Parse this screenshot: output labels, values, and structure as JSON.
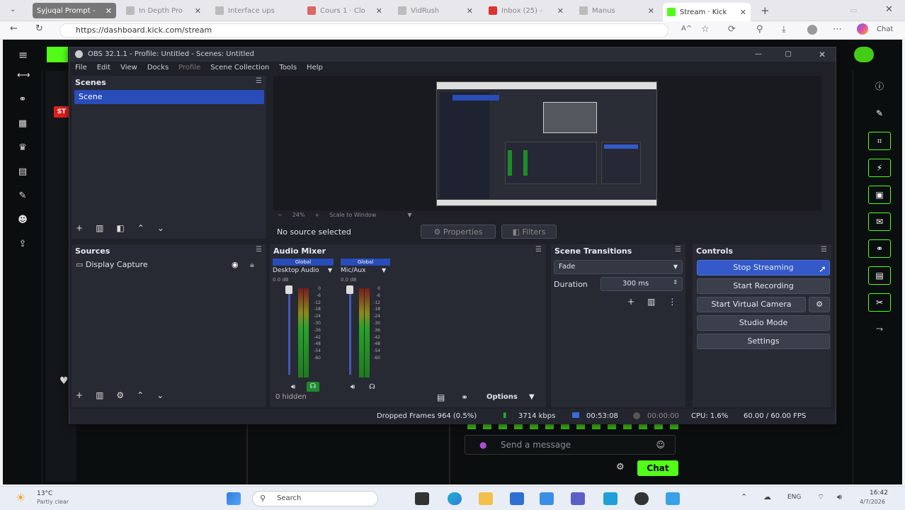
{
  "browser": {
    "tabs": [
      {
        "label": "Syjuqal Prompt -",
        "active": false
      },
      {
        "label": "In Depth Pro",
        "active": false
      },
      {
        "label": "Interface ups",
        "active": false
      },
      {
        "label": "Cours 1 · Clo",
        "active": false
      },
      {
        "label": "VidRush",
        "active": false
      },
      {
        "label": "Inbox (25) -",
        "active": false
      },
      {
        "label": "Manus",
        "active": false
      },
      {
        "label": "Stream · Kick",
        "active": true
      }
    ],
    "url": "https://dashboard.kick.com/stream",
    "reader_icon": "A^",
    "chat_label": "Chat"
  },
  "obs": {
    "title": "OBS 32.1.1 - Profile: Untitled - Scenes: Untitled",
    "menu": [
      "File",
      "Edit",
      "View",
      "Docks",
      "Profile",
      "Scene Collection",
      "Tools",
      "Help"
    ],
    "scenes_title": "Scenes",
    "scene_item": "Scene",
    "preview_zoom": "24%",
    "preview_scale": "Scale to Window",
    "no_source": "No source selected",
    "properties": "Properties",
    "filters": "Filters",
    "sources_title": "Sources",
    "source_item": "Display Capture",
    "mixer_title": "Audio Mixer",
    "mixer_hidden": "0 hidden",
    "mixer_options": "Options",
    "channels": [
      {
        "badge": "Global",
        "name": "Desktop Audio",
        "db": "0.0 dB"
      },
      {
        "badge": "Global",
        "name": "Mic/Aux",
        "db": "0.0 dB"
      }
    ],
    "meter_scale": [
      "0",
      "-6",
      "-12",
      "-18",
      "-24",
      "-30",
      "-36",
      "-42",
      "-48",
      "-54",
      "-60"
    ],
    "transitions_title": "Scene Transitions",
    "transition_value": "Fade",
    "duration_label": "Duration",
    "duration_value": "300 ms",
    "controls_title": "Controls",
    "controls": {
      "stop_streaming": "Stop Streaming",
      "start_recording": "Start Recording",
      "start_virtual_camera": "Start Virtual Camera",
      "studio_mode": "Studio Mode",
      "settings": "Settings"
    },
    "status": {
      "dropped": "Dropped Frames 964 (0.5%)",
      "bitrate": "3714 kbps",
      "stream_time": "00:53:08",
      "rec_time": "00:00:00",
      "cpu": "CPU: 1.6%",
      "fps": "60.00 / 60.00 FPS"
    }
  },
  "kick": {
    "chat_placeholder": "Send a message",
    "chat_button": "Chat",
    "live_badge": "ST",
    "accent": "#53fc18"
  },
  "taskbar": {
    "weather_temp": "13°C",
    "weather_desc": "Partly clear",
    "search": "Search",
    "lang": "ENG",
    "time": "16:42",
    "date": "4/7/2026"
  }
}
